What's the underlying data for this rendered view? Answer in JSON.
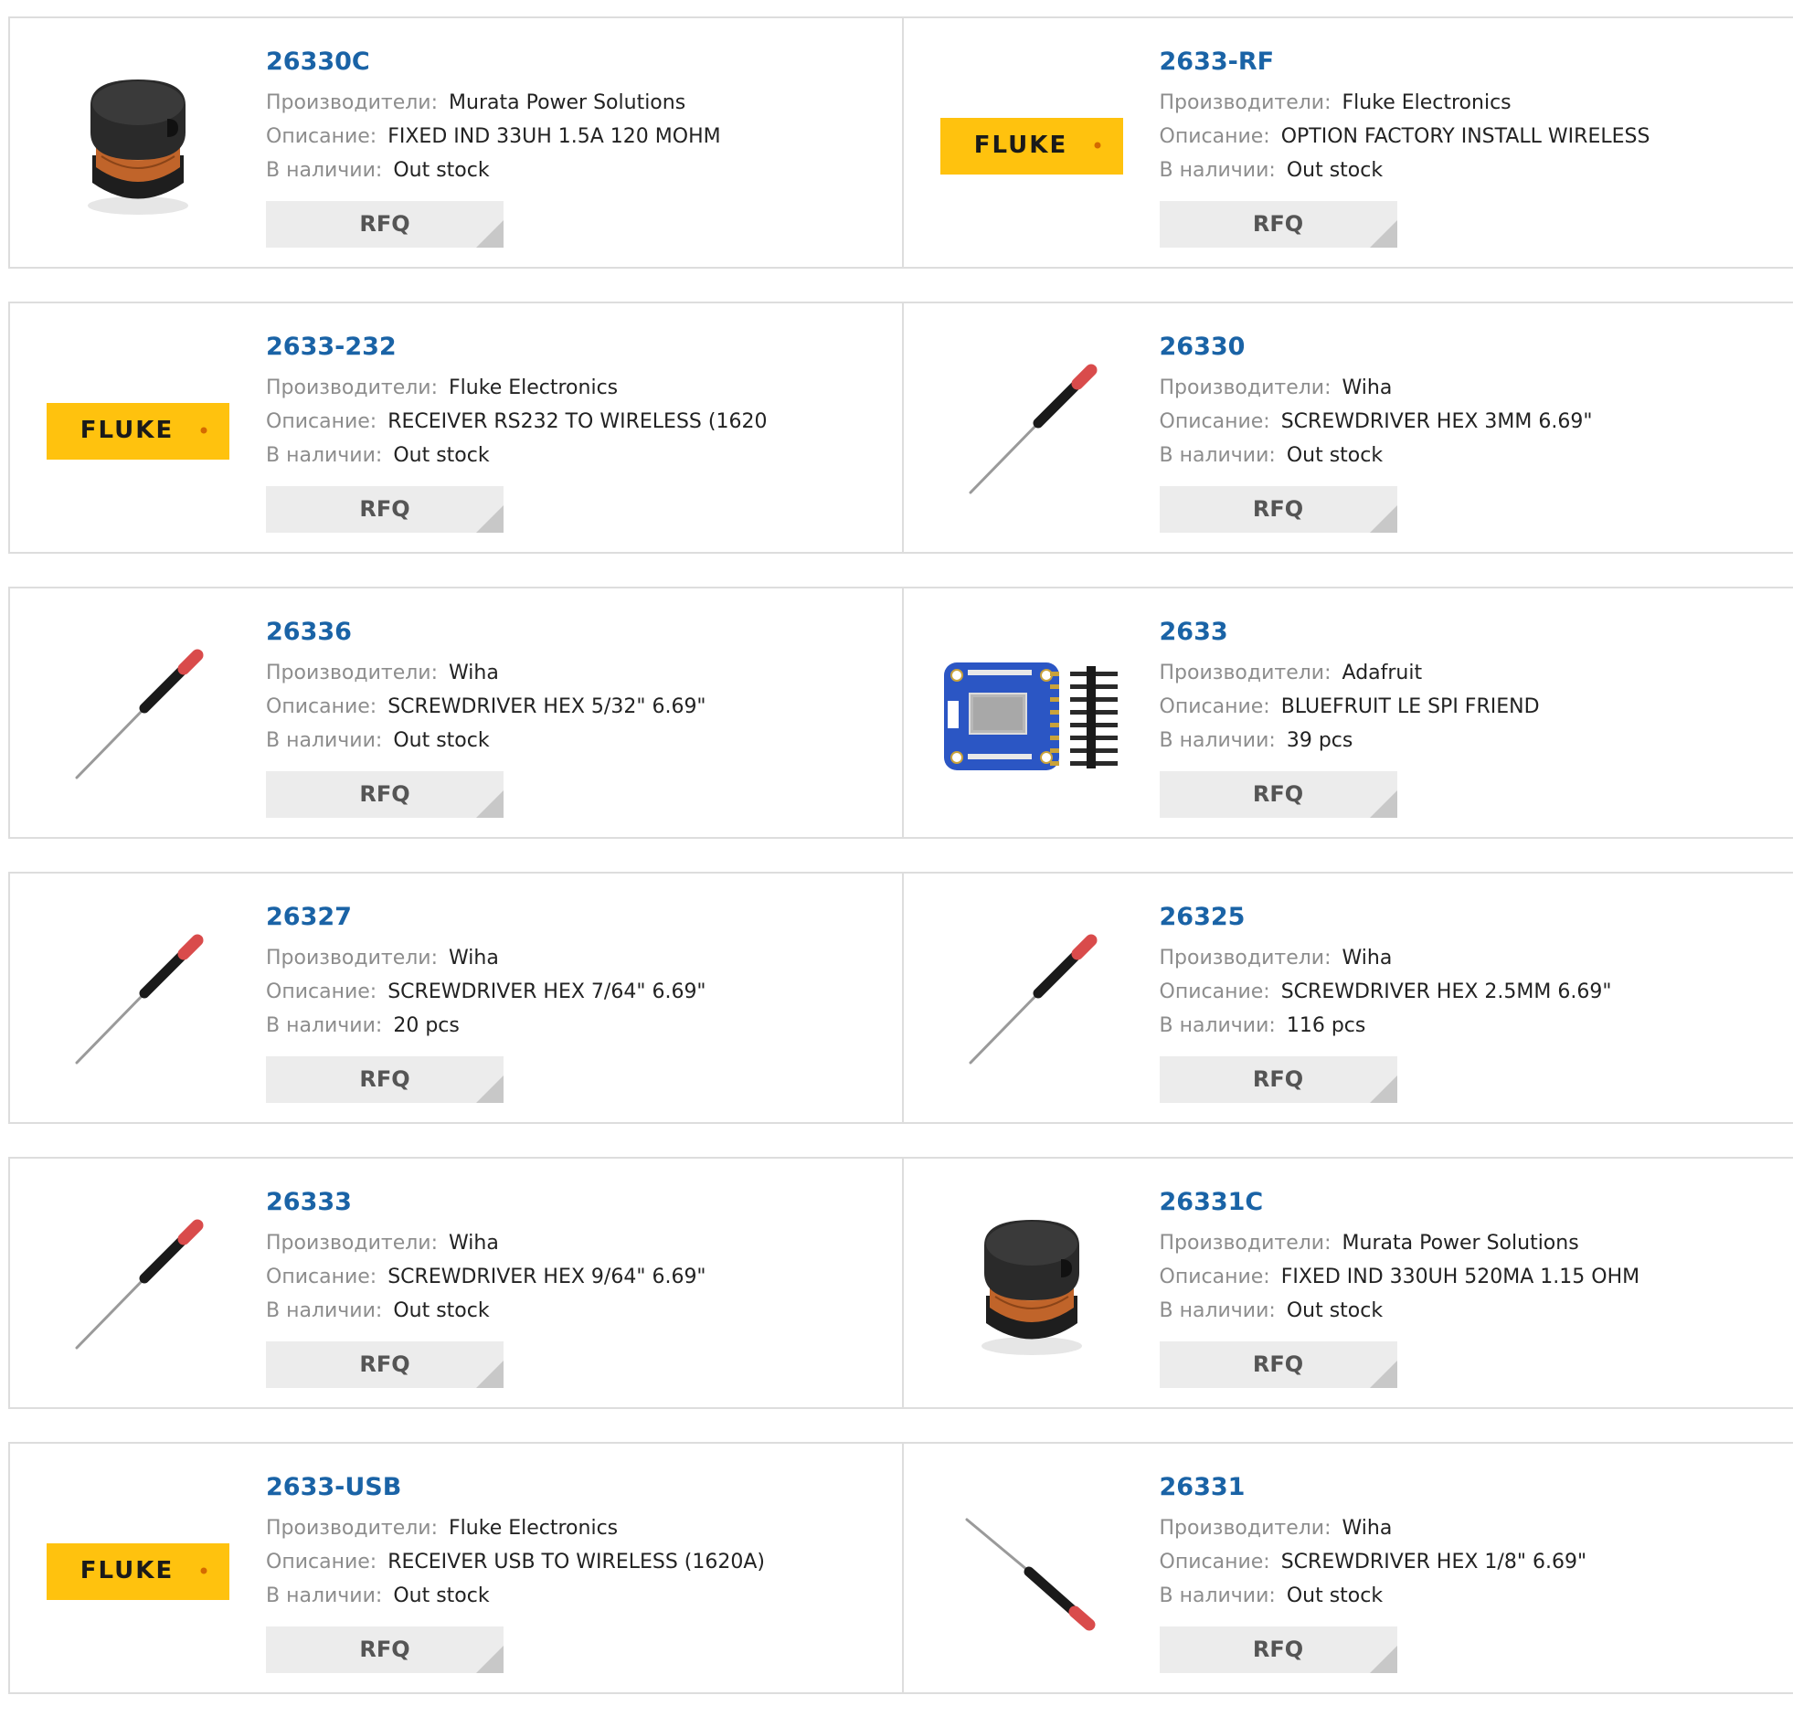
{
  "labels": {
    "manufacturer": "Производители:",
    "description": "Описание:",
    "stock": "В наличии:",
    "rfq": "RFQ"
  },
  "colors": {
    "link": "#1a63a6",
    "label": "#8d8d8d",
    "fluke_yellow": "#ffc20e",
    "rfq_bg": "#ececec"
  },
  "brand": {
    "fluke_logo": "FLUKE"
  },
  "products": [
    {
      "part": "26330C",
      "manufacturer": "Murata Power Solutions",
      "description": "FIXED IND 33UH 1.5A 120 MOHM",
      "stock": "Out stock",
      "image": "inductor-icon"
    },
    {
      "part": "2633-RF",
      "manufacturer": "Fluke Electronics",
      "description": "OPTION FACTORY INSTALL WIRELESS",
      "stock": "Out stock",
      "image": "fluke-logo"
    },
    {
      "part": "2633-232",
      "manufacturer": "Fluke Electronics",
      "description": "RECEIVER RS232 TO WIRELESS (1620",
      "stock": "Out stock",
      "image": "fluke-logo"
    },
    {
      "part": "26330",
      "manufacturer": "Wiha",
      "description": "SCREWDRIVER HEX 3MM 6.69\"",
      "stock": "Out stock",
      "image": "screwdriver-icon"
    },
    {
      "part": "26336",
      "manufacturer": "Wiha",
      "description": "SCREWDRIVER HEX 5/32\" 6.69\"",
      "stock": "Out stock",
      "image": "screwdriver-icon"
    },
    {
      "part": "2633",
      "manufacturer": "Adafruit",
      "description": "BLUEFRUIT LE SPI FRIEND",
      "stock": "39 pcs",
      "image": "circuit-board-icon"
    },
    {
      "part": "26327",
      "manufacturer": "Wiha",
      "description": "SCREWDRIVER HEX 7/64\" 6.69\"",
      "stock": "20 pcs",
      "image": "screwdriver-icon"
    },
    {
      "part": "26325",
      "manufacturer": "Wiha",
      "description": "SCREWDRIVER HEX 2.5MM 6.69\"",
      "stock": "116 pcs",
      "image": "screwdriver-icon"
    },
    {
      "part": "26333",
      "manufacturer": "Wiha",
      "description": "SCREWDRIVER HEX 9/64\" 6.69\"",
      "stock": "Out stock",
      "image": "screwdriver-icon"
    },
    {
      "part": "26331C",
      "manufacturer": "Murata Power Solutions",
      "description": "FIXED IND 330UH 520MA 1.15 OHM",
      "stock": "Out stock",
      "image": "inductor-icon"
    },
    {
      "part": "2633-USB",
      "manufacturer": "Fluke Electronics",
      "description": "RECEIVER USB TO WIRELESS (1620A)",
      "stock": "Out stock",
      "image": "fluke-logo"
    },
    {
      "part": "26331",
      "manufacturer": "Wiha",
      "description": "SCREWDRIVER HEX 1/8\" 6.69\"",
      "stock": "Out stock",
      "image": "screwdriver-icon-reversed"
    }
  ]
}
